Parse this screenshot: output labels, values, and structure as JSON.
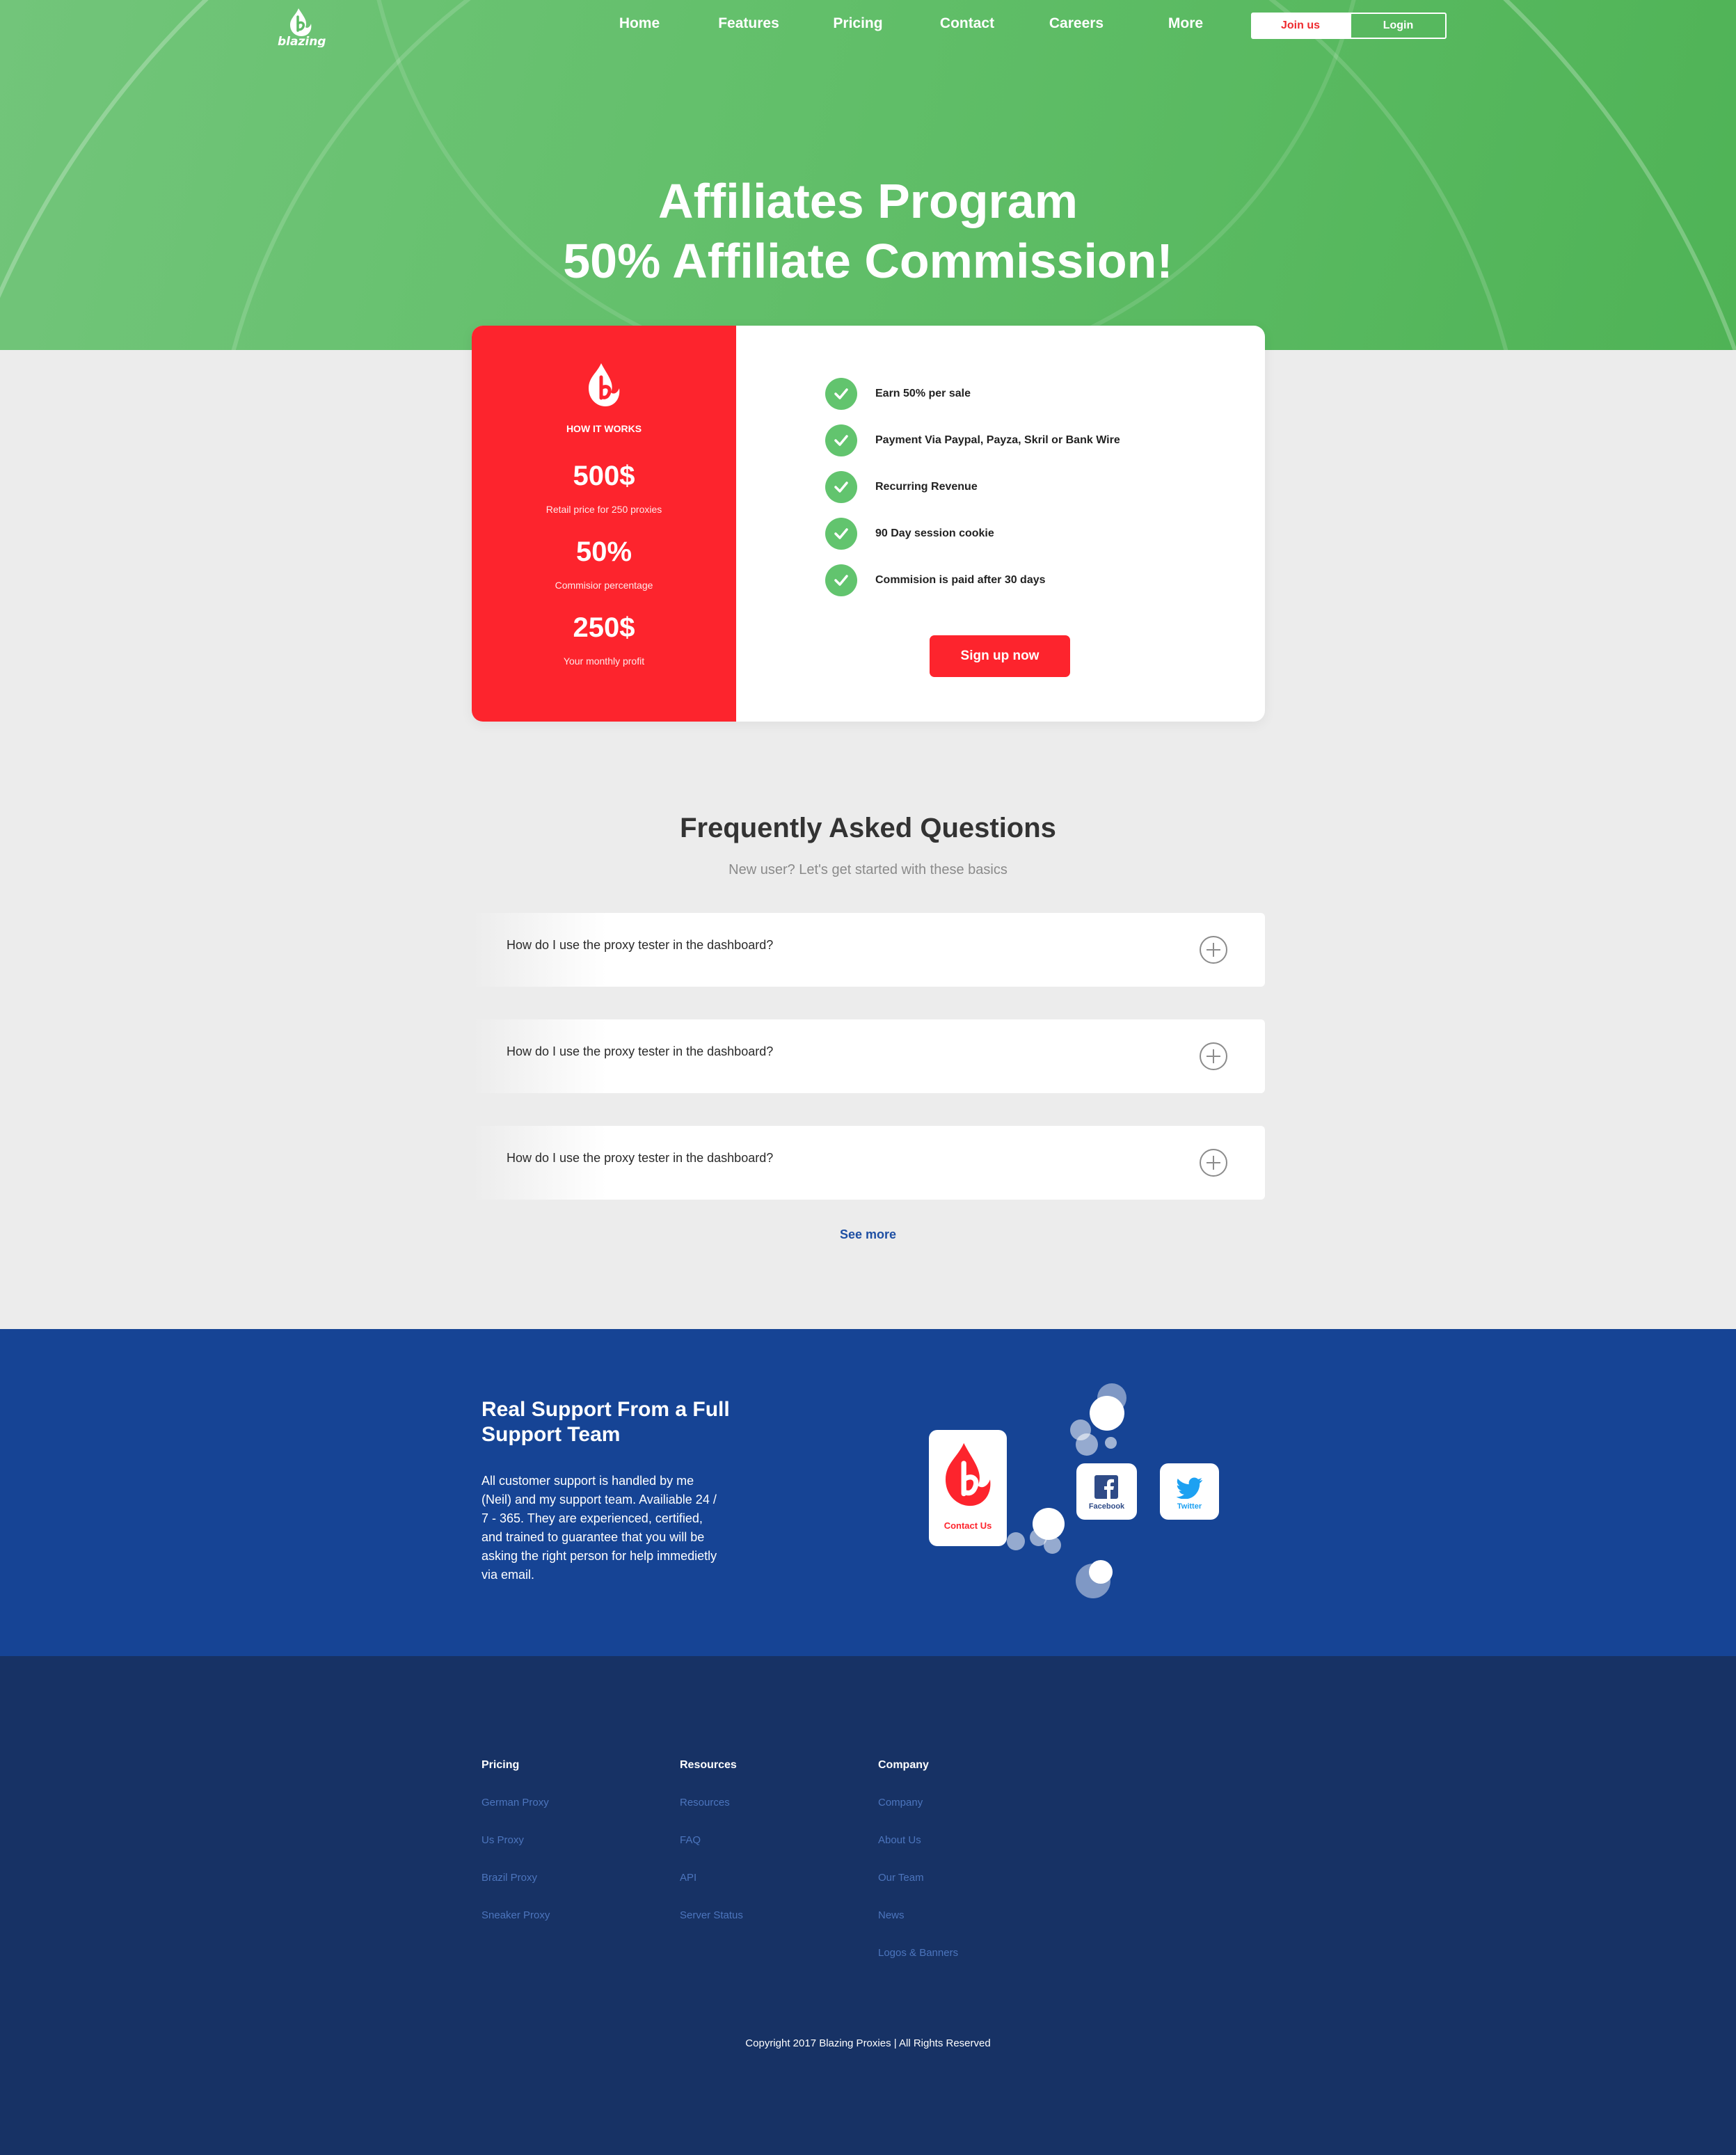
{
  "nav": {
    "logo_text": "blazing",
    "items": [
      "Home",
      "Features",
      "Pricing",
      "Contact",
      "Careers",
      "More"
    ],
    "join_label": "Join us",
    "login_label": "Login"
  },
  "hero": {
    "title_line1": "Affiliates Program",
    "title_line2": "50% Affiliate Commission!"
  },
  "how_it_works": {
    "heading": "HOW IT WORKS",
    "stats": [
      {
        "value": "500$",
        "label": "Retail price for 250 proxies"
      },
      {
        "value": "50%",
        "label": "Commisior percentage"
      },
      {
        "value": "250$",
        "label": "Your monthly profit"
      }
    ]
  },
  "features": [
    "Earn 50% per sale",
    "Payment Via Paypal, Payza, Skril or Bank Wire",
    "Recurring Revenue",
    "90 Day session cookie",
    "Commision is paid after 30 days"
  ],
  "signup_label": "Sign up now",
  "faq": {
    "title": "Frequently Asked Questions",
    "subtitle": "New user? Let's get started with these basics",
    "questions": [
      "How do I use the proxy tester in the dashboard?",
      "How do I use the proxy tester in the dashboard?",
      "How do I use the proxy tester in the dashboard?"
    ],
    "see_more": "See more"
  },
  "support": {
    "title": "Real Support From a Full Support Team",
    "text": "All customer support is handled by me (Neil) and my support team. Availiable 24 / 7 - 365. They are experienced, certified, and trained to guarantee that you will be asking the right person for help immedietly via email.",
    "contact_label": "Contact Us",
    "facebook_label": "Facebook",
    "twitter_label": "Twitter"
  },
  "footer": {
    "columns": [
      {
        "heading": "Pricing",
        "links": [
          "German Proxy",
          "Us Proxy",
          "Brazil Proxy",
          "Sneaker Proxy"
        ]
      },
      {
        "heading": "Resources",
        "links": [
          "Resources",
          "FAQ",
          "API",
          "Server Status"
        ]
      },
      {
        "heading": "Company",
        "links": [
          "Company",
          "About Us",
          "Our Team",
          "News",
          "Logos & Banners"
        ]
      }
    ],
    "copyright": "Copyright 2017 Blazing Proxies | All Rights Reserved"
  },
  "colors": {
    "hero_green": "#5dbb65",
    "brand_red": "#fd242d",
    "check_green": "#62c46e",
    "support_blue": "#164495",
    "footer_navy": "#173265",
    "link_blue": "#4c75bd"
  }
}
